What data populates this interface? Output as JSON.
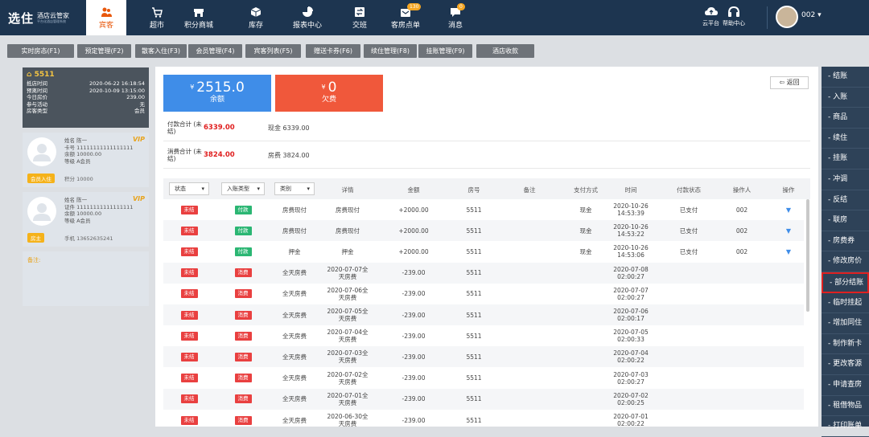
{
  "header": {
    "logo_main": "选住",
    "logo_title": "酒店云管家",
    "logo_tagline": "平台化酒店管理系统",
    "nav": [
      {
        "label": "宾客",
        "icon": "guests-icon",
        "active": true
      },
      {
        "label": "超市",
        "icon": "cart-icon"
      },
      {
        "label": "积分商城",
        "icon": "store-icon"
      },
      {
        "label": "库存",
        "icon": "box-icon"
      },
      {
        "label": "报表中心",
        "icon": "pie-chart-icon"
      },
      {
        "label": "交班",
        "icon": "handover-icon"
      },
      {
        "label": "客房点单",
        "icon": "room-order-icon",
        "badge": "130"
      },
      {
        "label": "消息",
        "icon": "message-icon",
        "badge": "0"
      }
    ],
    "cloud_label": "云平台",
    "help_label": "帮助中心",
    "user": "002"
  },
  "tabs": [
    "实时房态(F1)",
    "预定管理(F2)",
    "散客入住(F3)",
    "会员管理(F4)",
    "宾客列表(F5)",
    "赠送卡券(F6)",
    "续住管理(F8)",
    "挂账管理(F9)",
    "酒店收款"
  ],
  "room": {
    "number": "5511",
    "rows": [
      {
        "label": "抵店时间",
        "value": "2020-06-22 16:18:54"
      },
      {
        "label": "预离时间",
        "value": "2020-10-09 13:15:00"
      },
      {
        "label": "今日房价",
        "value": "239.00"
      },
      {
        "label": "参与活动",
        "value": "无"
      },
      {
        "label": "房客类型",
        "value": "会员"
      }
    ]
  },
  "guests": [
    {
      "name": "姓名 陈一",
      "l2": "卡号 11111111111111111",
      "l3": "余额 10000.00",
      "l4": "等级 A会员",
      "tag": "会员入住",
      "l5": "积分 10000",
      "vip": "VIP"
    },
    {
      "name": "姓名 陈一",
      "l2": "证件 11111111111111111",
      "l3": "余额 10000.00",
      "l4": "等级 A会员",
      "tag": "房主",
      "l5": "手机 13652635241",
      "vip": "VIP"
    }
  ],
  "remark_label": "备注:",
  "balance": {
    "currency": "¥",
    "amount": "2515.0",
    "label": "余额",
    "color": "#3f8de8"
  },
  "debt": {
    "currency": "¥",
    "amount": "0",
    "label": "欠费",
    "color": "#f0583b"
  },
  "back_label": "返回",
  "summary": {
    "paid_label": "付款合计 (未结)",
    "paid_amount": "6339.00",
    "paid_detail": "现金 6339.00",
    "cost_label": "消费合计 (未结)",
    "cost_amount": "3824.00",
    "cost_detail": "房费 3824.00"
  },
  "filters": {
    "status": "状态",
    "entry_type": "入账类型",
    "category": "类别"
  },
  "columns": [
    "详情",
    "金额",
    "房号",
    "备注",
    "支付方式",
    "时间",
    "付款状态",
    "操作人",
    "操作"
  ],
  "rows": [
    {
      "status": "未结",
      "kind": "付款",
      "category": "房费现付",
      "detail": "房费现付",
      "amount": "+2000.00",
      "room": "5511",
      "note": "",
      "method": "现金",
      "time": "2020-10-26 14:53:39",
      "pay_status": "已支付",
      "operator": "002",
      "action": true
    },
    {
      "status": "未结",
      "kind": "付款",
      "category": "房费现付",
      "detail": "房费现付",
      "amount": "+2000.00",
      "room": "5511",
      "note": "",
      "method": "现金",
      "time": "2020-10-26 14:53:22",
      "pay_status": "已支付",
      "operator": "002",
      "action": true
    },
    {
      "status": "未结",
      "kind": "付款",
      "category": "押金",
      "detail": "押金",
      "amount": "+2000.00",
      "room": "5511",
      "note": "",
      "method": "现金",
      "time": "2020-10-26 14:53:06",
      "pay_status": "已支付",
      "operator": "002",
      "action": true
    },
    {
      "status": "未结",
      "kind": "消费",
      "category": "全天房费",
      "detail": "2020-07-07全天房费",
      "amount": "-239.00",
      "room": "5511",
      "note": "",
      "method": "",
      "time": "2020-07-08 02:00:27",
      "pay_status": "",
      "operator": "",
      "action": false
    },
    {
      "status": "未结",
      "kind": "消费",
      "category": "全天房费",
      "detail": "2020-07-06全天房费",
      "amount": "-239.00",
      "room": "5511",
      "note": "",
      "method": "",
      "time": "2020-07-07 02:00:27",
      "pay_status": "",
      "operator": "",
      "action": false
    },
    {
      "status": "未结",
      "kind": "消费",
      "category": "全天房费",
      "detail": "2020-07-05全天房费",
      "amount": "-239.00",
      "room": "5511",
      "note": "",
      "method": "",
      "time": "2020-07-06 02:00:17",
      "pay_status": "",
      "operator": "",
      "action": false
    },
    {
      "status": "未结",
      "kind": "消费",
      "category": "全天房费",
      "detail": "2020-07-04全天房费",
      "amount": "-239.00",
      "room": "5511",
      "note": "",
      "method": "",
      "time": "2020-07-05 02:00:33",
      "pay_status": "",
      "operator": "",
      "action": false
    },
    {
      "status": "未结",
      "kind": "消费",
      "category": "全天房费",
      "detail": "2020-07-03全天房费",
      "amount": "-239.00",
      "room": "5511",
      "note": "",
      "method": "",
      "time": "2020-07-04 02:00:22",
      "pay_status": "",
      "operator": "",
      "action": false
    },
    {
      "status": "未结",
      "kind": "消费",
      "category": "全天房费",
      "detail": "2020-07-02全天房费",
      "amount": "-239.00",
      "room": "5511",
      "note": "",
      "method": "",
      "time": "2020-07-03 02:00:27",
      "pay_status": "",
      "operator": "",
      "action": false
    },
    {
      "status": "未结",
      "kind": "消费",
      "category": "全天房费",
      "detail": "2020-07-01全天房费",
      "amount": "-239.00",
      "room": "5511",
      "note": "",
      "method": "",
      "time": "2020-07-02 02:00:25",
      "pay_status": "",
      "operator": "",
      "action": false
    },
    {
      "status": "未结",
      "kind": "消费",
      "category": "全天房费",
      "detail": "2020-06-30全天房费",
      "amount": "-239.00",
      "room": "5511",
      "note": "",
      "method": "",
      "time": "2020-07-01 02:00:22",
      "pay_status": "",
      "operator": "",
      "action": false
    }
  ],
  "sidebar": [
    "- 结账",
    "- 入账",
    "- 商品",
    "- 续住",
    "- 挂账",
    "- 冲调",
    "- 反结",
    "- 联房",
    "- 房费券",
    "- 修改房价",
    "- 部分结账",
    "- 临时挂起",
    "- 增加同住",
    "- 制作新卡",
    "- 更改客源",
    "- 申请查房",
    "- 租借物品",
    "- 打印账单"
  ],
  "sidebar_highlight_index": 10
}
